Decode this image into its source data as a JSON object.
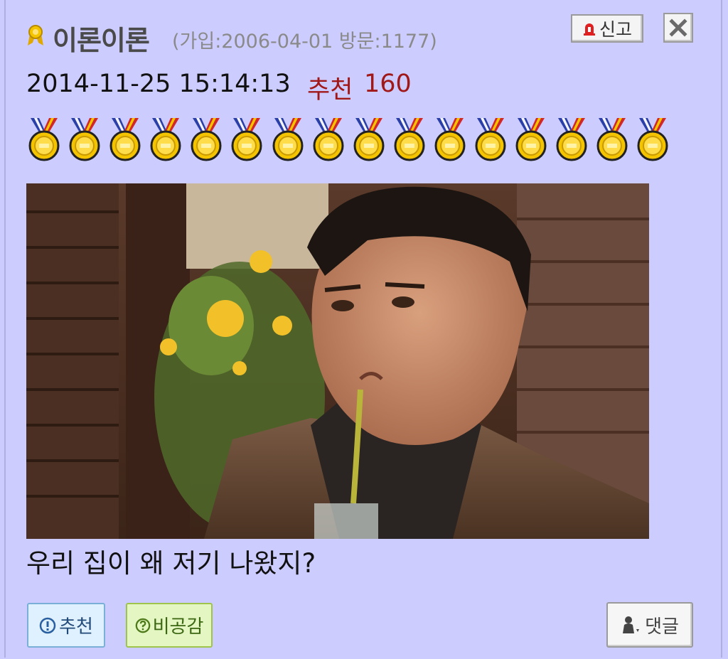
{
  "post": {
    "nickname": "이론이론",
    "member_info": "(가입:2006-04-01 방문:1177)",
    "datetime": "2014-11-25 15:14:13",
    "recommend_label": "추천",
    "recommend_count": "160",
    "medal_count": 16,
    "caption": "우리 집이 왜 저기 나왔지?"
  },
  "actions": {
    "report_label": "신고",
    "recommend_label": "추천",
    "disagree_label": "비공감",
    "comment_label": "댓글"
  },
  "icons": {
    "user": "ribbon-icon",
    "report": "siren-icon",
    "close": "close-icon",
    "recommend": "exclamation-circle-icon",
    "disagree": "question-circle-icon",
    "comment": "comment-person-icon",
    "medal": "medal-icon"
  },
  "colors": {
    "background": "#ccccff",
    "recommend_text": "#a01818",
    "recommend_button_bg": "#dff0ff",
    "disagree_button_bg": "#e4f7c2"
  }
}
